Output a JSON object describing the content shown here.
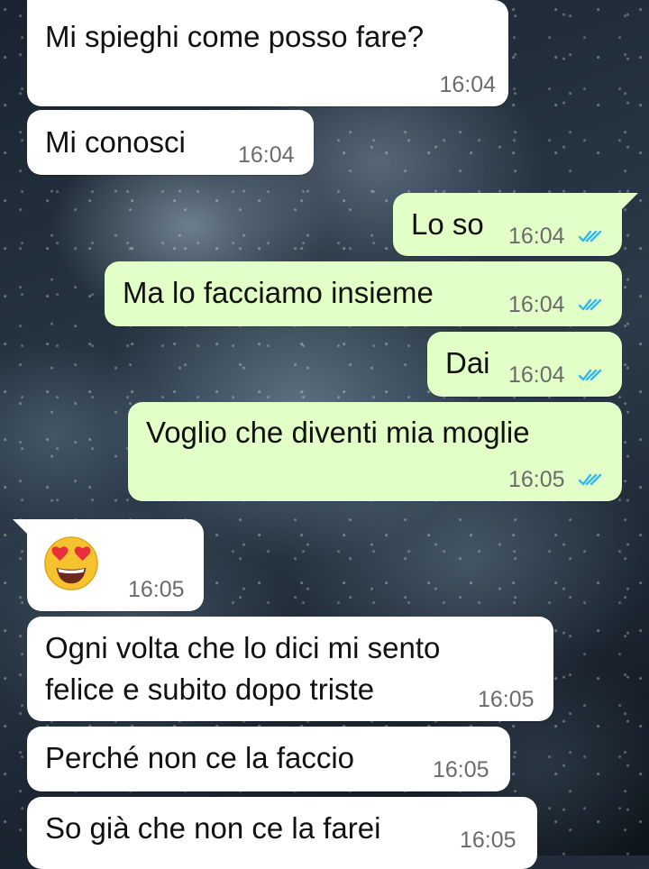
{
  "messages": [
    {
      "direction": "incoming",
      "text": "Mi spieghi come posso fare?",
      "time": "16:04"
    },
    {
      "direction": "incoming",
      "text": "Mi conosci",
      "time": "16:04"
    },
    {
      "direction": "outgoing",
      "text": "Lo so",
      "time": "16:04",
      "status_icon": "double-check-read"
    },
    {
      "direction": "outgoing",
      "text": "Ma lo facciamo insieme",
      "time": "16:04",
      "status_icon": "double-check-read"
    },
    {
      "direction": "outgoing",
      "text": "Dai",
      "time": "16:04",
      "status_icon": "double-check-read"
    },
    {
      "direction": "outgoing",
      "text": "Voglio che diventi mia moglie",
      "time": "16:05",
      "status_icon": "double-check-read"
    },
    {
      "direction": "incoming",
      "emoji_icon": "heart-eyes-emoji",
      "time": "16:05"
    },
    {
      "direction": "incoming",
      "lines": [
        "Ogni volta che lo dici mi sento",
        "felice e subito dopo triste"
      ],
      "time": "16:05"
    },
    {
      "direction": "incoming",
      "text": "Perché non ce la faccio",
      "time": "16:05"
    },
    {
      "direction": "incoming",
      "text": "So già che non ce la farei",
      "time": "16:05"
    }
  ],
  "colors": {
    "incoming_bubble": "#ffffff",
    "outgoing_bubble": "#e2ffc7",
    "read_ticks": "#34b7f1",
    "timestamp": "#6b6b6b"
  }
}
